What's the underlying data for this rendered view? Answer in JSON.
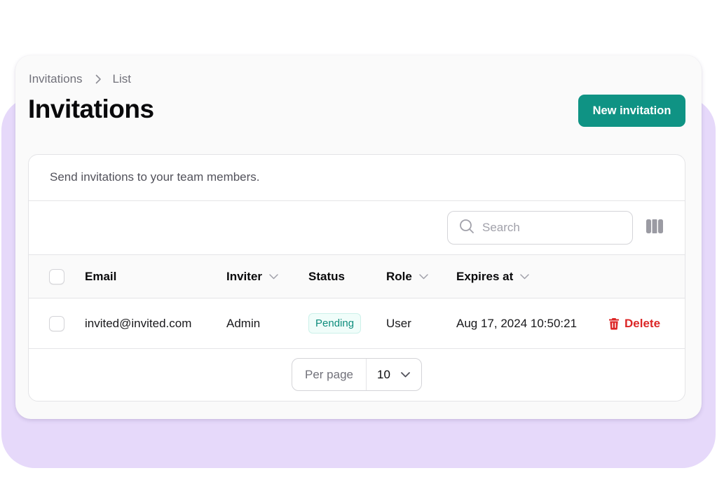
{
  "breadcrumb": [
    {
      "label": "Invitations"
    },
    {
      "label": "List"
    }
  ],
  "header": {
    "title": "Invitations",
    "new_button_label": "New invitation"
  },
  "card": {
    "description": "Send invitations to your team members.",
    "search": {
      "placeholder": "Search",
      "value": ""
    }
  },
  "table": {
    "columns": [
      {
        "label": "Email",
        "sortable": false
      },
      {
        "label": "Inviter",
        "sortable": true
      },
      {
        "label": "Status",
        "sortable": false
      },
      {
        "label": "Role",
        "sortable": true
      },
      {
        "label": "Expires at",
        "sortable": true
      }
    ],
    "rows": [
      {
        "email": "invited@invited.com",
        "inviter": "Admin",
        "status": "Pending",
        "role": "User",
        "expires_at": "Aug 17, 2024 10:50:21",
        "action_label": "Delete"
      }
    ]
  },
  "pagination": {
    "per_page_label": "Per page",
    "per_page_value": "10"
  },
  "colors": {
    "accent": "#0f9384",
    "danger": "#dc2626",
    "badge_text": "#0d8c7c",
    "background_blob": "#e6d9fa"
  }
}
